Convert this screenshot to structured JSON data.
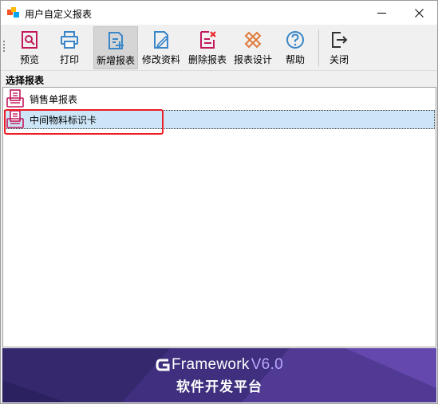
{
  "window": {
    "title": "用户自定义报表"
  },
  "toolbar": {
    "buttons": [
      {
        "label": "预览",
        "icon": "preview-icon"
      },
      {
        "label": "打印",
        "icon": "printer-icon"
      },
      {
        "label": "新增报表",
        "icon": "add-report-icon"
      },
      {
        "label": "修改资料",
        "icon": "edit-icon"
      },
      {
        "label": "删除报表",
        "icon": "delete-report-icon"
      },
      {
        "label": "报表设计",
        "icon": "design-icon"
      },
      {
        "label": "帮助",
        "icon": "help-icon"
      },
      {
        "label": "关闭",
        "icon": "exit-icon"
      }
    ],
    "active": "新增报表"
  },
  "section": {
    "title": "选择报表"
  },
  "reports": [
    {
      "name": "销售单报表"
    },
    {
      "name": "中间物料标识卡"
    }
  ],
  "selected": "中间物料标识卡",
  "banner": {
    "brand": "Framework",
    "version": "V6.0",
    "subtitle": "软件开发平台"
  },
  "colors": {
    "accent_red": "#ee1c24",
    "icon_blue": "#3a86c8",
    "icon_magenta": "#c2185b",
    "selection": "#cde6f7",
    "banner": "#3f2f7e"
  }
}
